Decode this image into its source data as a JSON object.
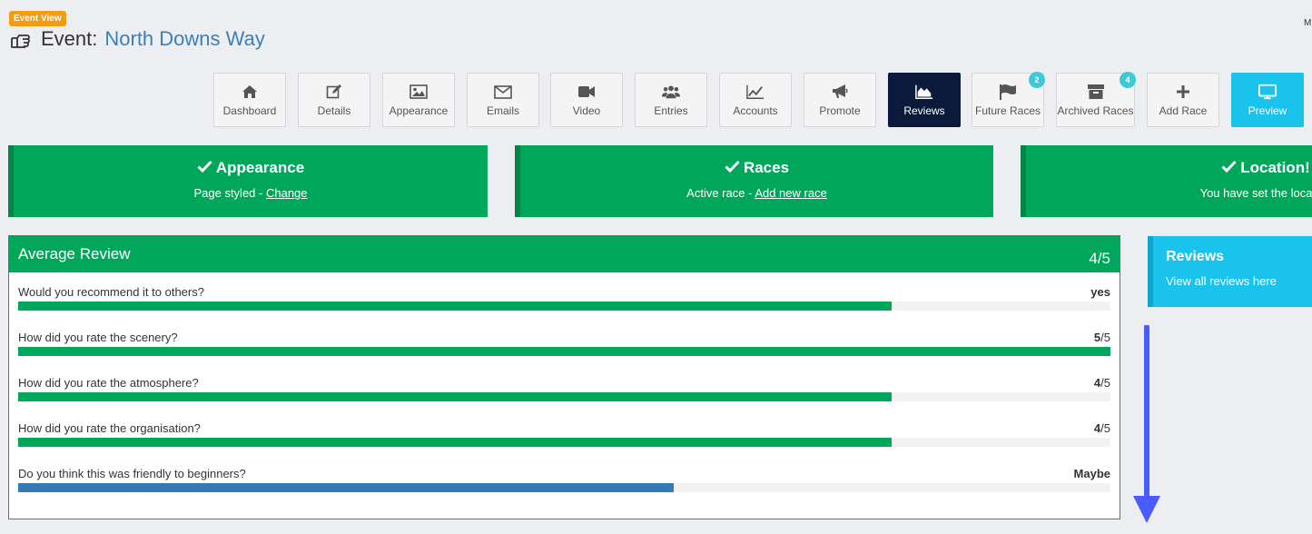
{
  "header": {
    "badge": "Event View",
    "title_prefix": "Event:",
    "event_name": "North Downs Way",
    "corner_text": "M"
  },
  "nav": [
    {
      "label": "Dashboard",
      "icon": "home-icon"
    },
    {
      "label": "Details",
      "icon": "edit-icon"
    },
    {
      "label": "Appearance",
      "icon": "image-icon"
    },
    {
      "label": "Emails",
      "icon": "envelope-icon"
    },
    {
      "label": "Video",
      "icon": "video-camera-icon"
    },
    {
      "label": "Entries",
      "icon": "users-icon"
    },
    {
      "label": "Accounts",
      "icon": "line-chart-icon"
    },
    {
      "label": "Promote",
      "icon": "megaphone-icon"
    },
    {
      "label": "Reviews",
      "icon": "area-chart-icon",
      "active": true
    },
    {
      "label": "Future Races",
      "icon": "flag-icon",
      "count": "2"
    },
    {
      "label": "Archived Races",
      "icon": "archive-icon",
      "count": "4"
    },
    {
      "label": "Add Race",
      "icon": "plus-icon"
    },
    {
      "label": "Preview",
      "icon": "monitor-icon"
    }
  ],
  "status_cards": [
    {
      "title": "Appearance",
      "text": "Page styled - ",
      "link": "Change"
    },
    {
      "title": "Races",
      "text": "Active race - ",
      "link": "Add new race"
    },
    {
      "title": "Location!",
      "text": "You have set the location",
      "link": ""
    }
  ],
  "average_review": {
    "heading": "Average Review",
    "score": "4/5",
    "questions": [
      {
        "question": "Would you recommend it to others?",
        "answer": "yes",
        "suffix": "",
        "fraction": 0.8,
        "color": "#00a65a"
      },
      {
        "question": "How did you rate the scenery?",
        "answer": "5",
        "suffix": "/5",
        "fraction": 1.0,
        "color": "#00a65a"
      },
      {
        "question": "How did you rate the atmosphere?",
        "answer": "4",
        "suffix": "/5",
        "fraction": 0.8,
        "color": "#00a65a"
      },
      {
        "question": "How did you rate the organisation?",
        "answer": "4",
        "suffix": "/5",
        "fraction": 0.8,
        "color": "#00a65a"
      },
      {
        "question": "Do you think this was friendly to beginners?",
        "answer": "Maybe",
        "suffix": "",
        "fraction": 0.6,
        "color": "#337ab7"
      }
    ]
  },
  "reviews_side": {
    "heading": "Reviews",
    "link": "View all reviews here"
  },
  "colors": {
    "green": "#00a65a",
    "blue_bar": "#337ab7",
    "nav_active": "#0b1a3b",
    "preview": "#19c3ec",
    "arrow": "#4a5cff"
  }
}
